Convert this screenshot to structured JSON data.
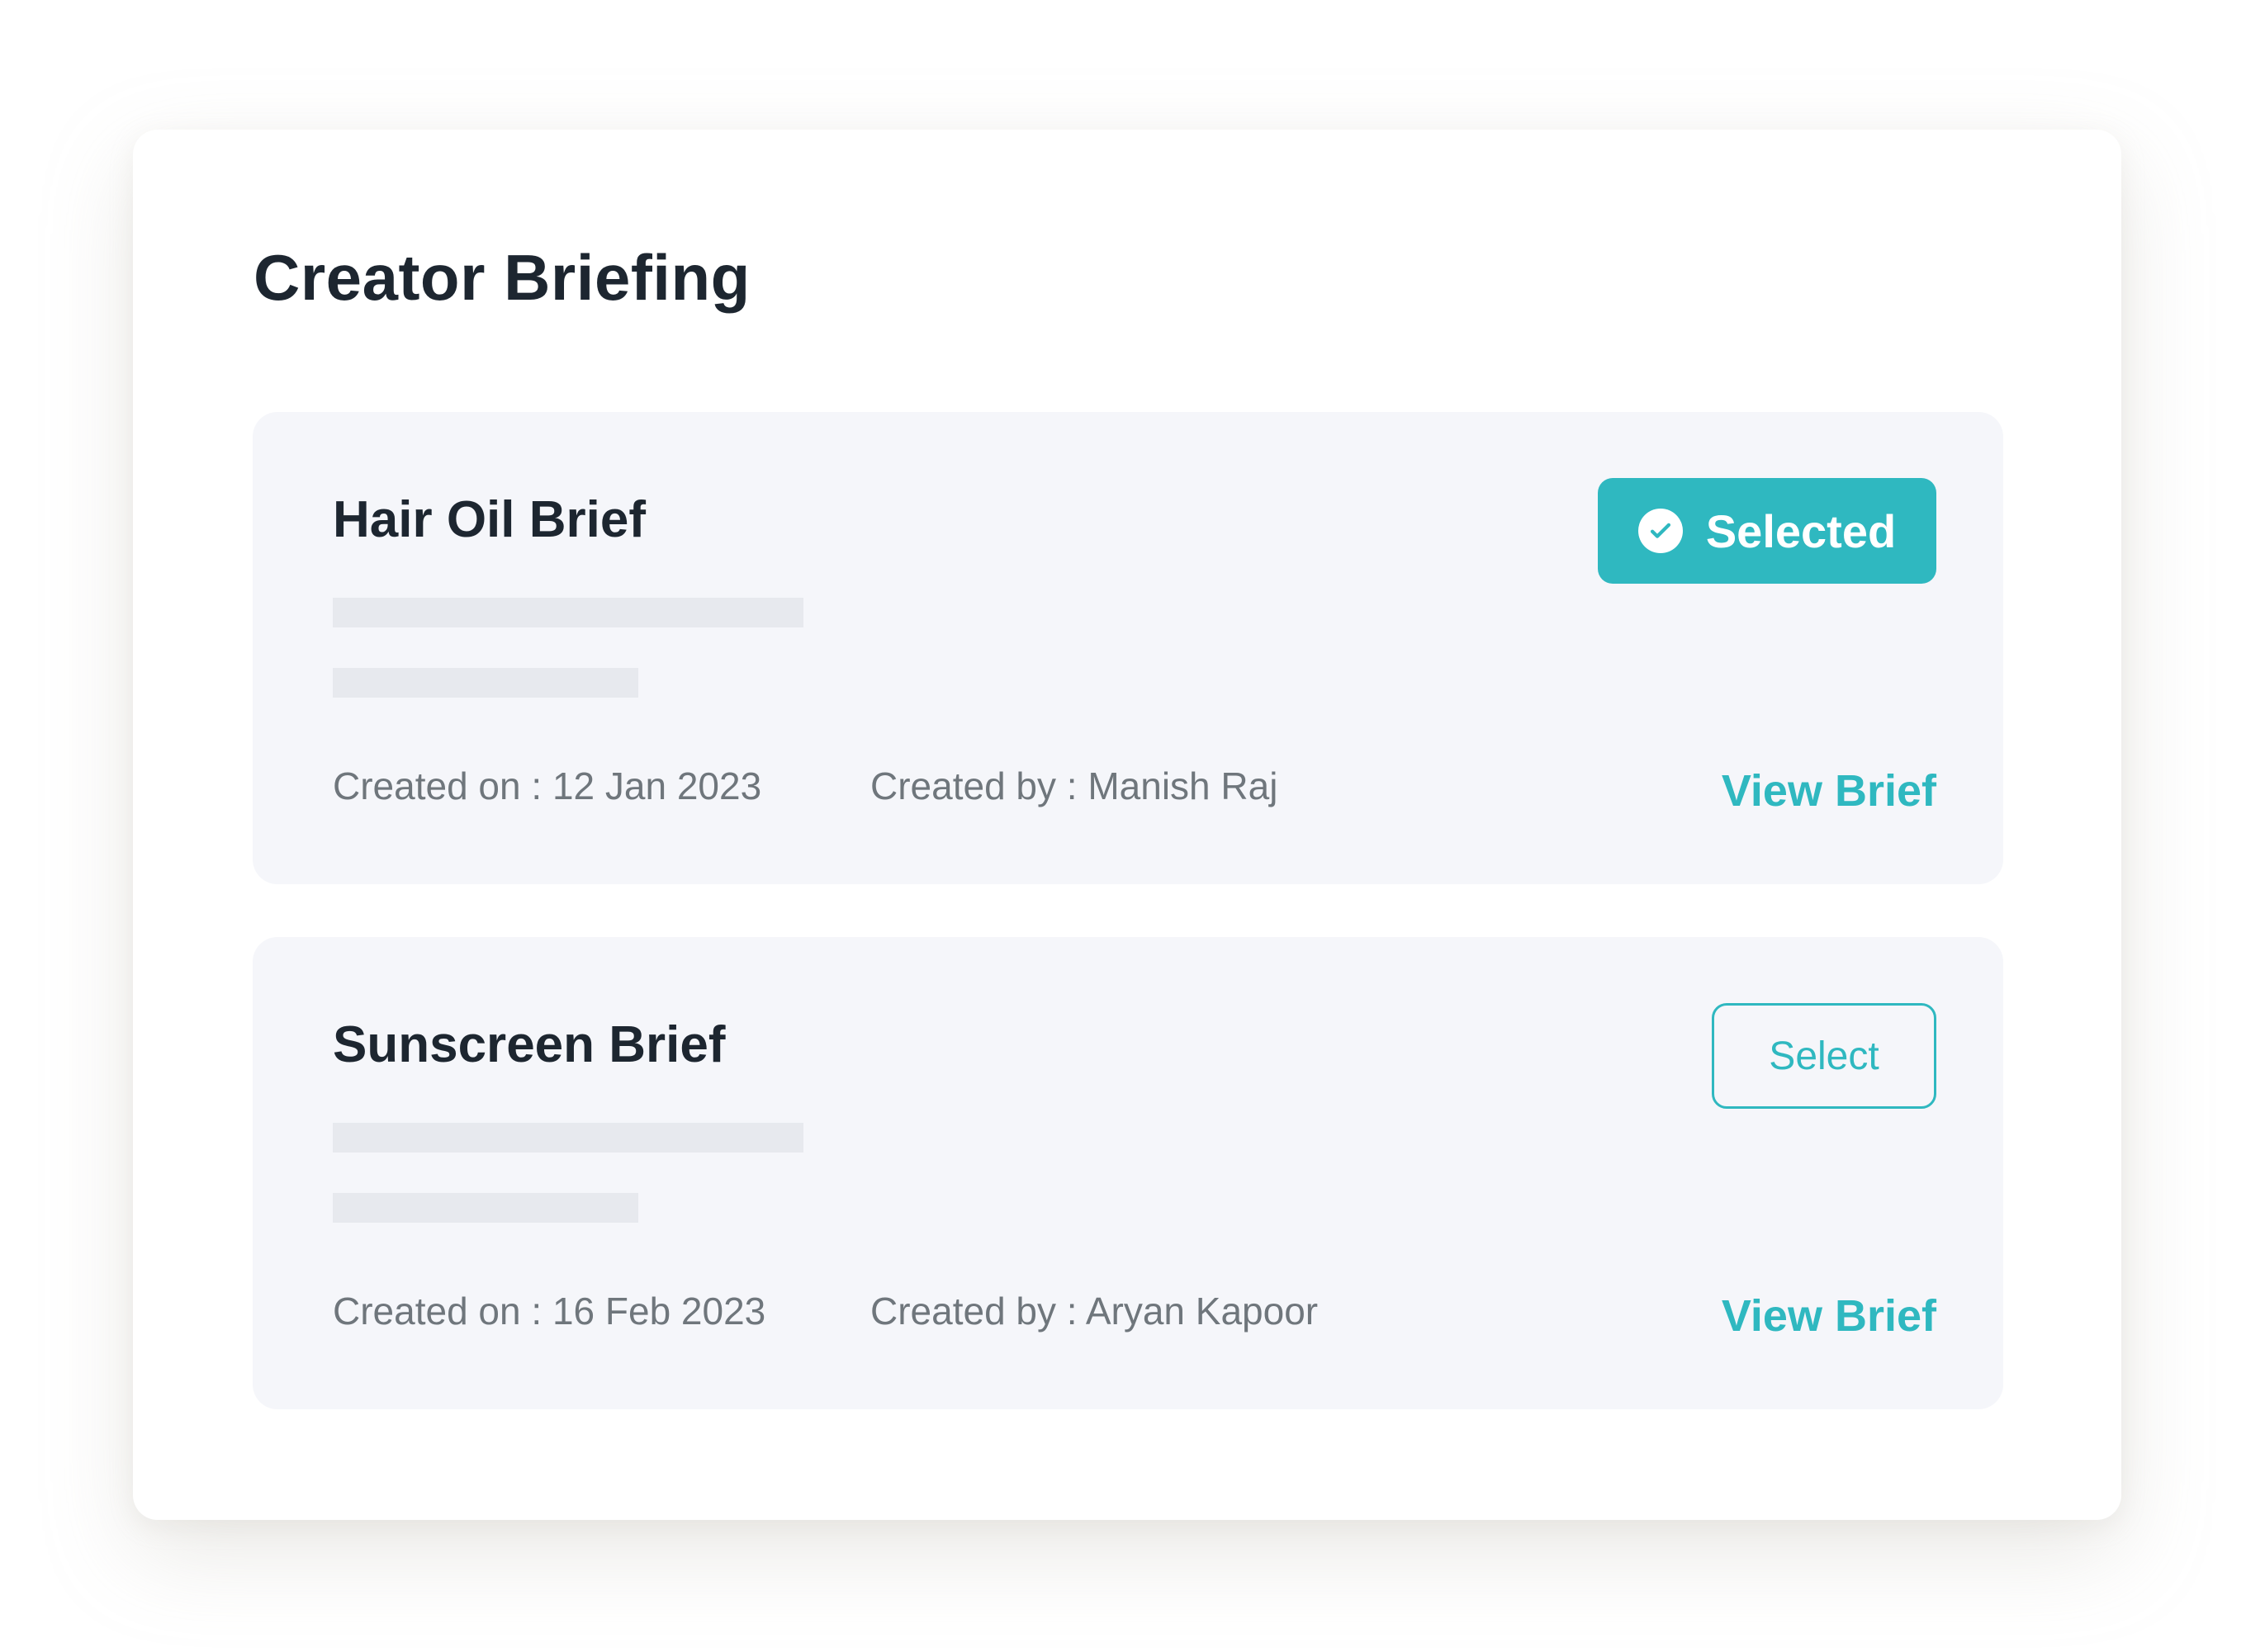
{
  "page": {
    "title": "Creator Briefing"
  },
  "briefs": [
    {
      "title": "Hair Oil Brief",
      "created_on": "Created on : 12 Jan 2023",
      "created_by": "Created by : Manish Raj",
      "action_label": "Selected",
      "action_state": "selected",
      "action_icon": "check-circle-icon",
      "view_label": "View Brief"
    },
    {
      "title": "Sunscreen Brief",
      "created_on": "Created on : 16 Feb 2023",
      "created_by": "Created by : Aryan Kapoor",
      "action_label": "Select",
      "action_state": "unselected",
      "view_label": "View Brief"
    }
  ],
  "colors": {
    "accent": "#2fb8c0",
    "title_text": "#1d2630",
    "meta_text": "#6f767c",
    "card_background": "#f5f6fa",
    "skeleton": "#e7e9ee"
  }
}
